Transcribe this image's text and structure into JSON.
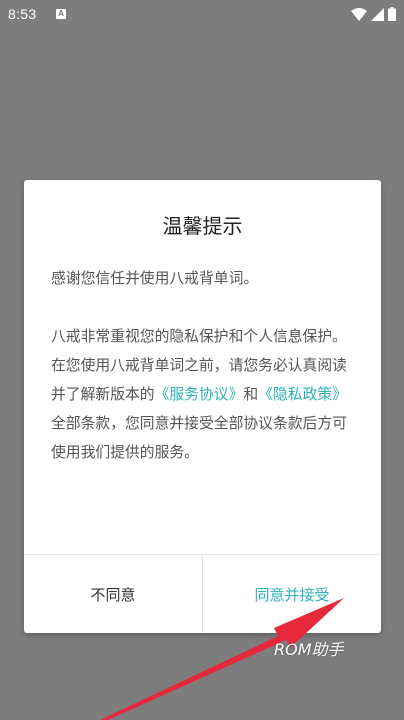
{
  "status_bar": {
    "time": "8:53",
    "notification_letter": "A"
  },
  "dialog": {
    "title": "温馨提示",
    "paragraph_1": "感谢您信任并使用八戒背单词。",
    "paragraph_2_before": "八戒非常重视您的隐私保护和个人信息保护。在您使用八戒背单词之前，请您务必认真阅读并了解新版本的",
    "link_service": "《服务协议》",
    "connector_and": "和",
    "link_privacy": "《隐私政策》",
    "paragraph_2_after": "全部条款，您同意并接受全部协议条款后方可使用我们提供的服务。",
    "disagree_label": "不同意",
    "agree_label": "同意并接受"
  },
  "watermark": "ROM助手",
  "colors": {
    "accent": "#2fb3b8",
    "annotation_arrow": "#e5283a",
    "scrim": "#7d7d7d"
  }
}
